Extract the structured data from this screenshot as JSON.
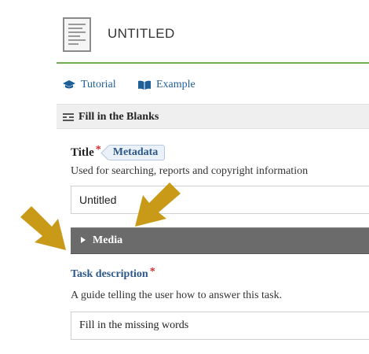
{
  "header": {
    "title": "UNTITLED",
    "doc_icon": "document-thumbnail-icon"
  },
  "links": [
    {
      "label": "Tutorial",
      "icon": "graduation-cap-icon"
    },
    {
      "label": "Example",
      "icon": "open-book-icon"
    }
  ],
  "section": {
    "label": "Fill in the Blanks",
    "icon": "fill-blanks-icon"
  },
  "title_field": {
    "label": "Title",
    "required_mark": "*",
    "tag": "Metadata",
    "help": "Used for searching, reports and copyright information",
    "value": "Untitled"
  },
  "media": {
    "label": "Media",
    "icon": "caret-right-icon"
  },
  "task_field": {
    "label": "Task description",
    "required_mark": "*",
    "help": "A guide telling the user how to answer this task.",
    "value": "Fill in the missing words"
  },
  "annotations": {
    "arrow_color": "#c99a18",
    "arrow_icon": "pointer-arrow-icon"
  },
  "colors": {
    "accent_green": "#6fb24f",
    "link_blue": "#1f5f97",
    "media_bar": "#6b6b6b",
    "required_red": "#d12d2d"
  }
}
